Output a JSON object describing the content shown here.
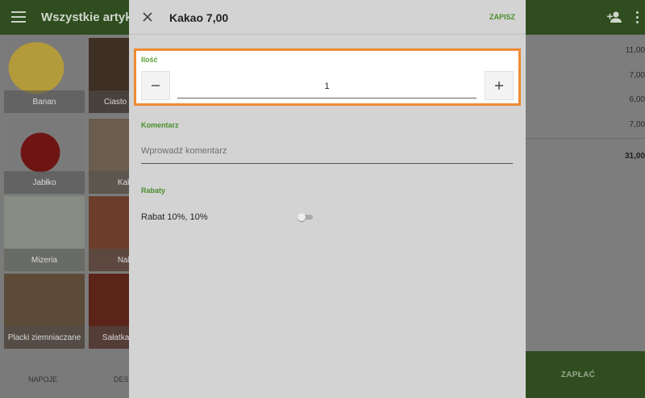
{
  "appbar": {
    "title": "Wszystkie artykuły"
  },
  "products": [
    {
      "label": "Banan"
    },
    {
      "label": "Ciasto czekol."
    },
    {
      "label": "Jabłko"
    },
    {
      "label": "Kakao"
    },
    {
      "label": "Mizeria"
    },
    {
      "label": "Naleś."
    },
    {
      "label": "Placki ziemniaczane"
    },
    {
      "label": "Sałatka pomid."
    }
  ],
  "bottom_tabs": [
    {
      "label": "NAPOJE"
    },
    {
      "label": "DESE"
    }
  ],
  "receipt": {
    "prices": [
      "11,00",
      "7,00",
      "6,00",
      "7,00"
    ],
    "total": "31,00",
    "pay_label": "ZAPŁAĆ"
  },
  "dialog": {
    "title": "Kakao 7,00",
    "save_label": "ZAPISZ",
    "quantity": {
      "label": "Ilość",
      "value": "1"
    },
    "comment": {
      "label": "Komentarz",
      "placeholder": "Wprowadź komentarz",
      "value": ""
    },
    "discounts": {
      "label": "Rabaty",
      "items": [
        {
          "label": "Rabat 10%, 10%",
          "enabled": false
        }
      ]
    }
  },
  "colors": {
    "accent": "#4a8d2c",
    "highlight": "#ef8a34",
    "appbar": "#2f4d1f"
  },
  "icons": [
    "menu-icon",
    "add-user-icon",
    "more-vert-icon",
    "close-icon",
    "minus-icon",
    "plus-icon"
  ]
}
